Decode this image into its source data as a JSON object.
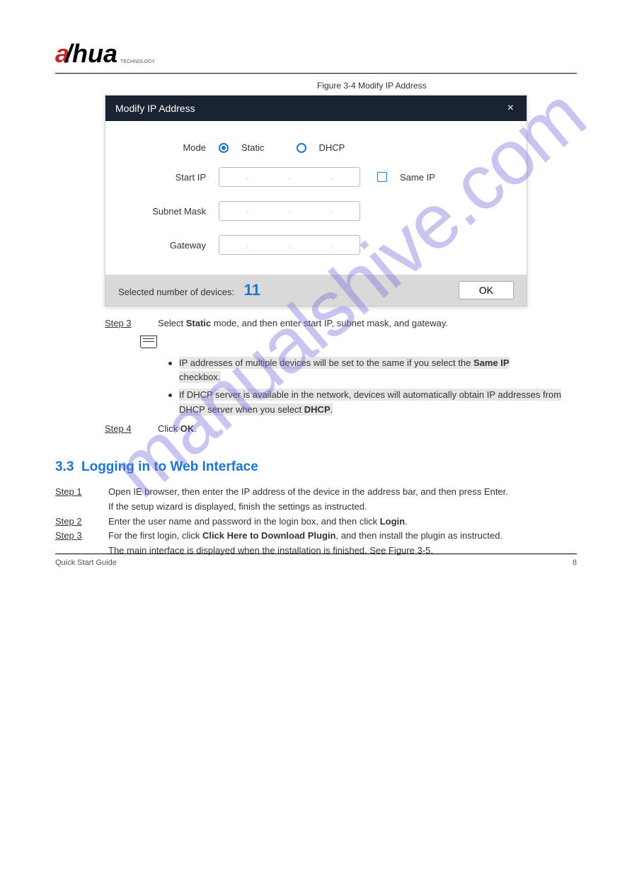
{
  "logo": {
    "a1": "a",
    "hua": "/hua",
    "tech": "TECHNOLOGY"
  },
  "watermark": "manualshive.com",
  "fig_caption": "Figure 3-4 Modify IP Address",
  "dialog": {
    "title": "Modify IP Address",
    "close": "×",
    "mode_label": "Mode",
    "static": "Static",
    "dhcp": "DHCP",
    "start_ip": "Start IP",
    "same_ip": "Same IP",
    "subnet": "Subnet Mask",
    "gateway": "Gateway",
    "selected_label": "Selected number of devices:",
    "selected_count": "11",
    "ok": "OK"
  },
  "steps": {
    "s3": {
      "label": "Step 3",
      "text_pre": "Select ",
      "bold1": "Static",
      "text_mid": " mode, and then enter start IP, subnet mask, and gateway."
    },
    "note1_pre": "IP addresses of multiple devices will be set to the same if you select the ",
    "note1_bold": "Same IP",
    "note1_post": " checkbox.",
    "note2_pre": "If DHCP server is available in the network, devices will automatically obtain IP addresses from DHCP server when you select ",
    "note2_bold": "DHCP",
    "note2_post": ".",
    "s4": {
      "label": "Step 4",
      "text_pre": "Click ",
      "bold1": "OK",
      "text_post": "."
    }
  },
  "section": {
    "num": "3.3",
    "title": "Logging in to Web Interface",
    "s1": {
      "label": "Step 1",
      "text": "Open IE browser, then enter the IP address of the device in the address bar, and then press Enter."
    },
    "s1_cont": "If the setup wizard is displayed, finish the settings as instructed.",
    "s2": {
      "label": "Step 2",
      "text": "Enter the user name and password in the login box, and then click ",
      "bold": "Login",
      "post": "."
    },
    "s3": {
      "label": "Step 3",
      "text_pre": "For the first login, click ",
      "bold1": "Click Here to Download Plugin",
      "mid": ", and then install the plugin as instructed."
    },
    "s3_cont": "The main interface is displayed when the installation is finished. See Figure 3-5."
  },
  "footer": {
    "left": "Quick Start Guide",
    "right": "8"
  }
}
